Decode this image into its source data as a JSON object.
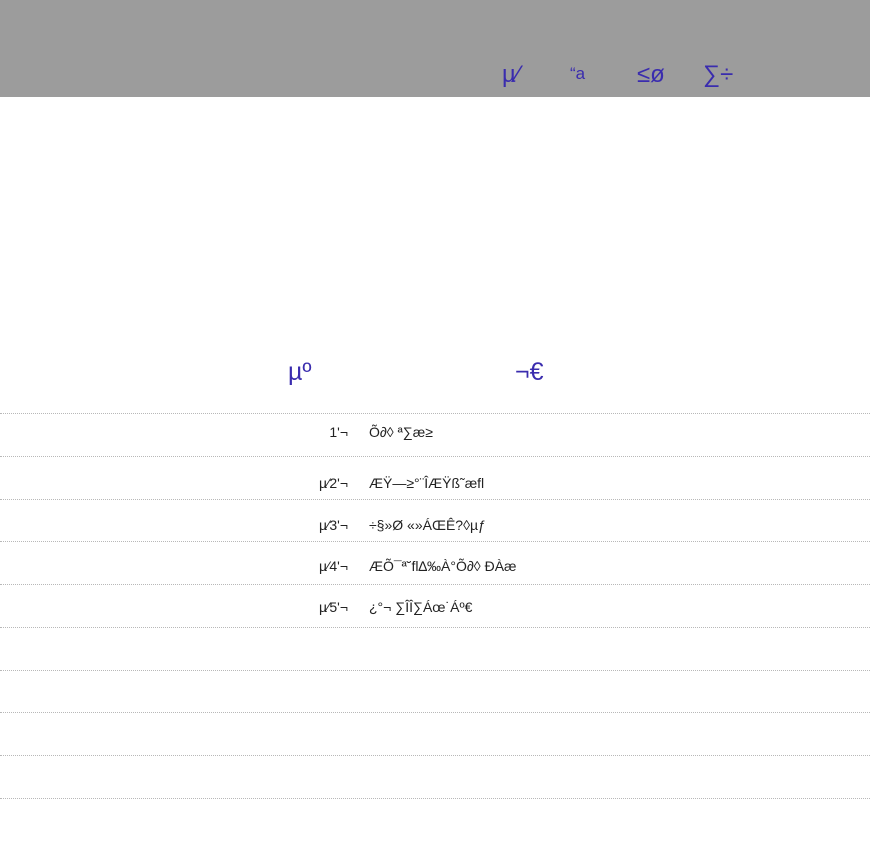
{
  "header": {
    "nav": [
      {
        "label": "µ⁄"
      },
      {
        "label": "“a"
      },
      {
        "label": "≤ø"
      },
      {
        "label": "∑÷"
      }
    ]
  },
  "section": {
    "col1": "µº",
    "col2": "¬€"
  },
  "rows": [
    {
      "num": "1'¬",
      "text": "Õ∂◊ ª∑æ≥"
    },
    {
      "num": "µ⁄2'¬",
      "text": "ÆŸ—≥°¨ÎÆŸß˜æﬂ"
    },
    {
      "num": "µ⁄3'¬",
      "text": "÷§»Ø «»ÁŒÊ?◊µƒ"
    },
    {
      "num": "µ⁄4'¬",
      "text": "ÆÕ¯ª˘ﬂ∆‰À°Õ∂◊ ÐÀæ"
    },
    {
      "num": "µ⁄5'¬",
      "text": "¿°¬ ∑ÎÎ∑Áœ˙Áº€"
    }
  ]
}
